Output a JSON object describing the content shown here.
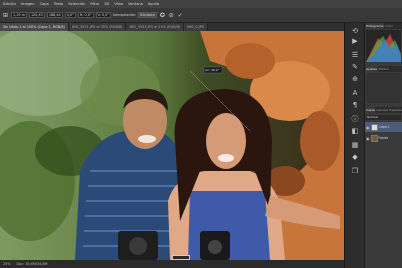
{
  "menubar": {
    "items": [
      "Edición",
      "Imagen",
      "Capa",
      "Texto",
      "Selección",
      "Filtro",
      "3D",
      "Vista",
      "Ventana",
      "Ayuda"
    ]
  },
  "options": {
    "fields": [
      "1,19 m",
      "120,43",
      "168,44",
      "0,0°",
      "H: 0,0°",
      "V: 0,0°"
    ],
    "interpolation_label": "Interpolación:",
    "interpolation_value": "Bicúbica"
  },
  "doc": {
    "tabs": [
      "Sin título-1 al 100% (Capa 1, RGB/8)",
      "IMG_3521.JPG al 50% (RGB/8)",
      "IMG_3533.JPG al 25% (RGB/8)",
      "IMG_0.JPG"
    ]
  },
  "status": {
    "zoom": "25%",
    "doc_size": "Doc: 34,6M/34,6M"
  },
  "tooltip": "An: 48,2°",
  "panels": {
    "tabs_top": [
      "Histograma",
      "Color"
    ],
    "tabs_mid": [
      "Ajustes",
      "Estilos"
    ],
    "tabs_layers": [
      "Capas",
      "Canales",
      "Trazados"
    ],
    "blend": "Normal",
    "layers": [
      "Capa 1",
      "Fondo"
    ]
  },
  "colors": {
    "accent": "#2d6fd6",
    "histogram": [
      "#e0453c",
      "#44b05a",
      "#3b7ae0"
    ]
  }
}
